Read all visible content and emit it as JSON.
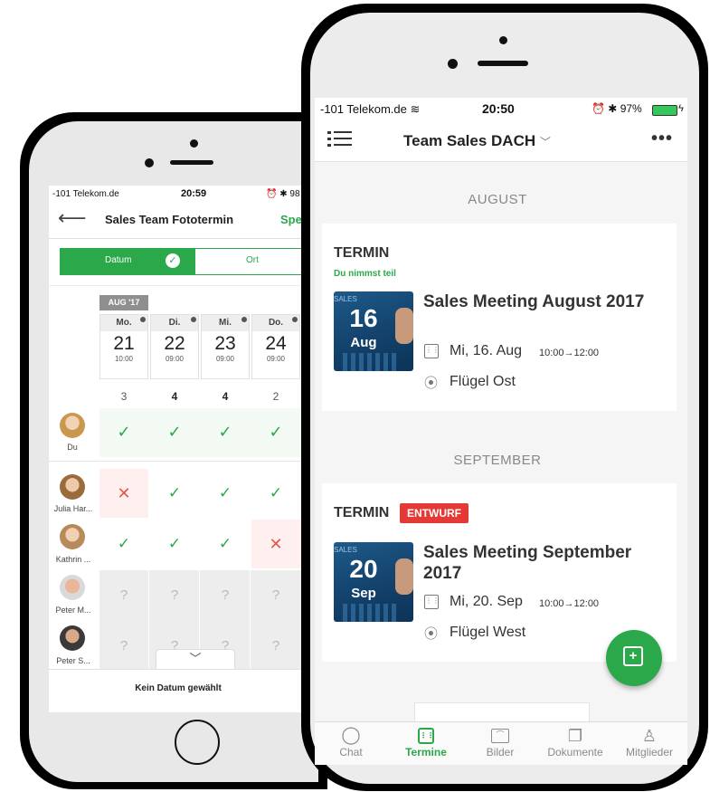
{
  "back": {
    "status": {
      "carrier": "-101 Telekom.de",
      "time": "20:59",
      "battery": "98"
    },
    "header": {
      "title": "Sales Team Fototermin",
      "action": "Spe"
    },
    "segments": {
      "datum": "Datum",
      "ort": "Ort"
    },
    "month_badge": "AUG '17",
    "days": [
      {
        "weekday": "Mo.",
        "day": "21",
        "time": "10:00",
        "count": "3"
      },
      {
        "weekday": "Di.",
        "day": "22",
        "time": "09:00",
        "count": "4"
      },
      {
        "weekday": "Mi.",
        "day": "23",
        "time": "09:00",
        "count": "4"
      },
      {
        "weekday": "Do.",
        "day": "24",
        "time": "09:00",
        "count": "2"
      }
    ],
    "rows": [
      {
        "name": "Du",
        "marks": [
          "✓",
          "✓",
          "✓",
          "✓"
        ]
      },
      {
        "name": "Julia Har...",
        "marks": [
          "✕",
          "✓",
          "✓",
          "✓"
        ]
      },
      {
        "name": "Kathrin ...",
        "marks": [
          "✓",
          "✓",
          "✓",
          "✕"
        ]
      },
      {
        "name": "Peter M...",
        "marks": [
          "?",
          "?",
          "?",
          "?"
        ]
      },
      {
        "name": "Peter S...",
        "marks": [
          "?",
          "?",
          "?",
          "?"
        ]
      }
    ],
    "footer": "Kein Datum gewählt"
  },
  "front": {
    "status": {
      "carrier": "-101 Telekom.de",
      "time": "20:50",
      "battery": "97%"
    },
    "header": {
      "title": "Team Sales DACH"
    },
    "sections": [
      {
        "month": "AUGUST",
        "kind": "TERMIN",
        "note": "Du nimmst teil",
        "badge": "",
        "thumb_label": "SALES",
        "thumb_day": "16",
        "thumb_month": "Aug",
        "title": "Sales Meeting August 2017",
        "date": "Mi, 16. Aug",
        "time": "10:00→12:00",
        "place": "Flügel Ost"
      },
      {
        "month": "SEPTEMBER",
        "kind": "TERMIN",
        "note": "",
        "badge": "ENTWURF",
        "thumb_label": "SALES",
        "thumb_day": "20",
        "thumb_month": "Sep",
        "title": "Sales Meeting September 2017",
        "date": "Mi, 20. Sep",
        "time": "10:00→12:00",
        "place": "Flügel West"
      }
    ],
    "tabs": [
      {
        "label": "Chat",
        "icon": "chat-icon"
      },
      {
        "label": "Termine",
        "icon": "calendar-icon"
      },
      {
        "label": "Bilder",
        "icon": "image-icon"
      },
      {
        "label": "Dokumente",
        "icon": "documents-icon"
      },
      {
        "label": "Mitglieder",
        "icon": "members-icon"
      }
    ],
    "active_tab": "Termine",
    "colors": {
      "accent": "#2aa84a",
      "draft": "#e53935"
    }
  }
}
